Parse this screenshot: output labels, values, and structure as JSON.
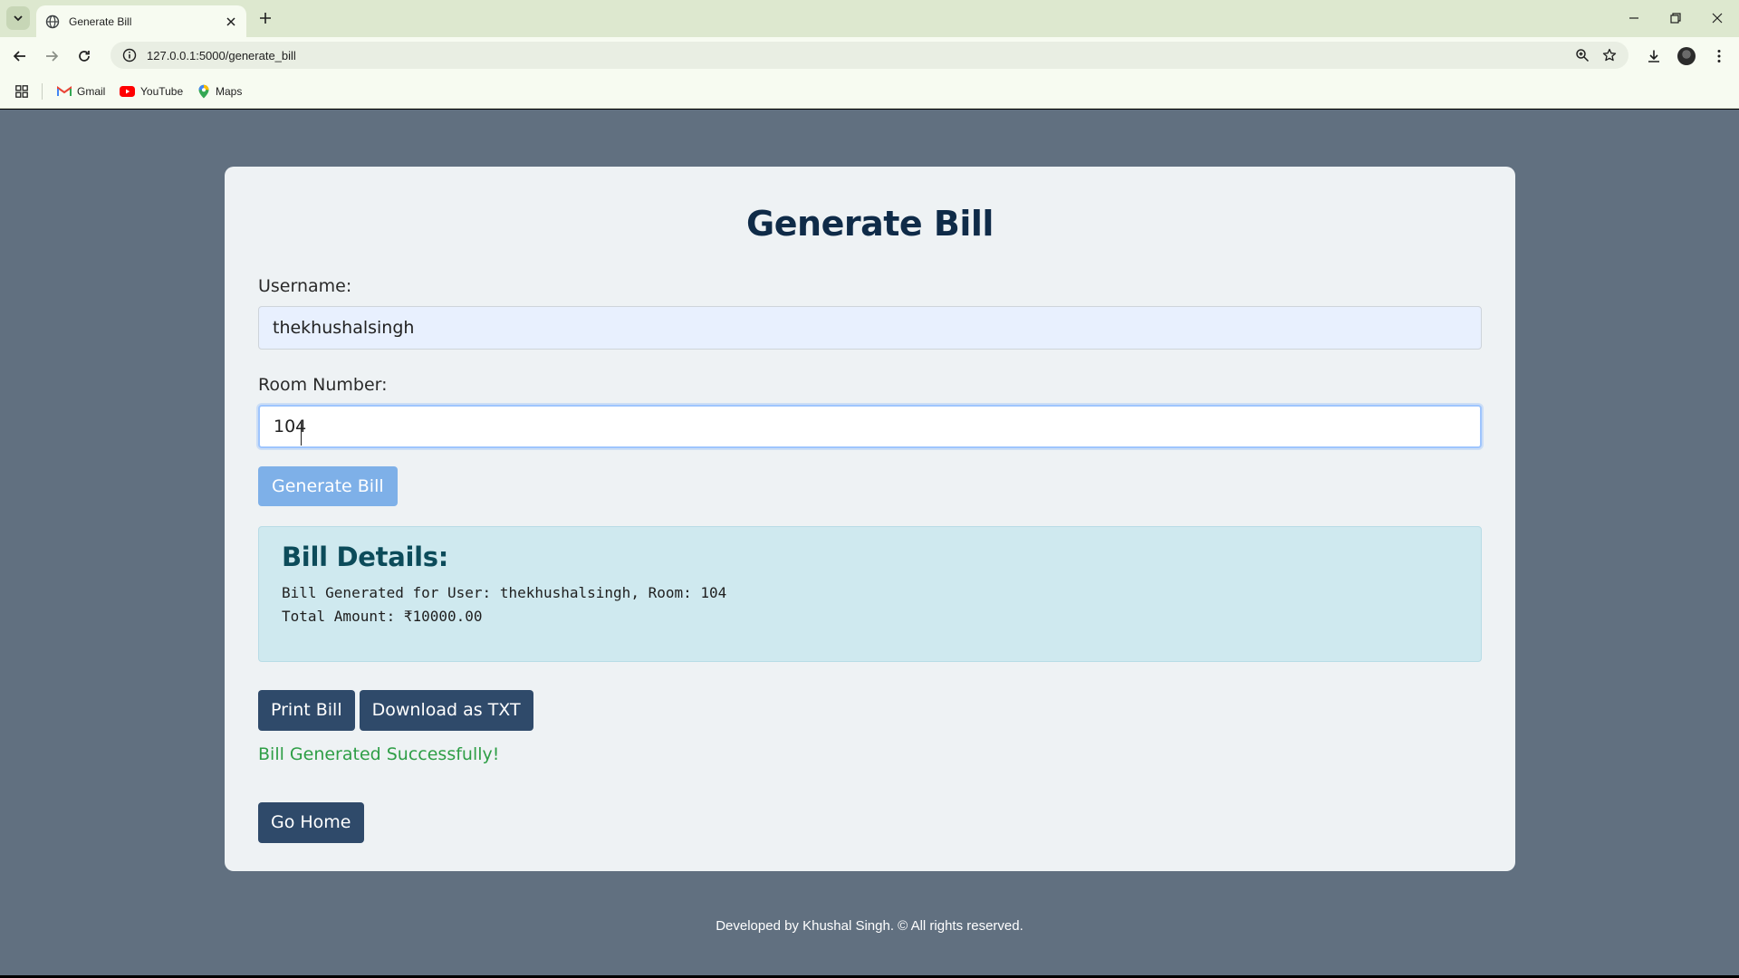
{
  "browser": {
    "tab_title": "Generate Bill",
    "url": "127.0.0.1:5000/generate_bill",
    "bookmarks": [
      {
        "label": "Gmail",
        "icon": "gmail-icon"
      },
      {
        "label": "YouTube",
        "icon": "youtube-icon"
      },
      {
        "label": "Maps",
        "icon": "maps-icon"
      }
    ]
  },
  "form": {
    "title": "Generate Bill",
    "username_label": "Username:",
    "username_value": "thekhushalsingh",
    "room_label": "Room Number:",
    "room_value": "104",
    "generate_button": "Generate Bill"
  },
  "bill": {
    "heading": "Bill Details:",
    "line1": "Bill Generated for User: thekhushalsingh, Room: 104",
    "line2": "Total Amount: ₹10000.00"
  },
  "actions": {
    "print_button": "Print Bill",
    "download_button": "Download as TXT",
    "success_message": "Bill Generated Successfully!",
    "home_button": "Go Home"
  },
  "footer": {
    "text": "Developed by Khushal Singh. © All rights reserved."
  },
  "colors": {
    "page_bg": "#617080",
    "card_bg": "#eef2f4",
    "primary_dark": "#2f4a6a",
    "generate_btn": "#7eb0e8",
    "success": "#2e9e46",
    "bill_box": "#cfe9ef"
  }
}
